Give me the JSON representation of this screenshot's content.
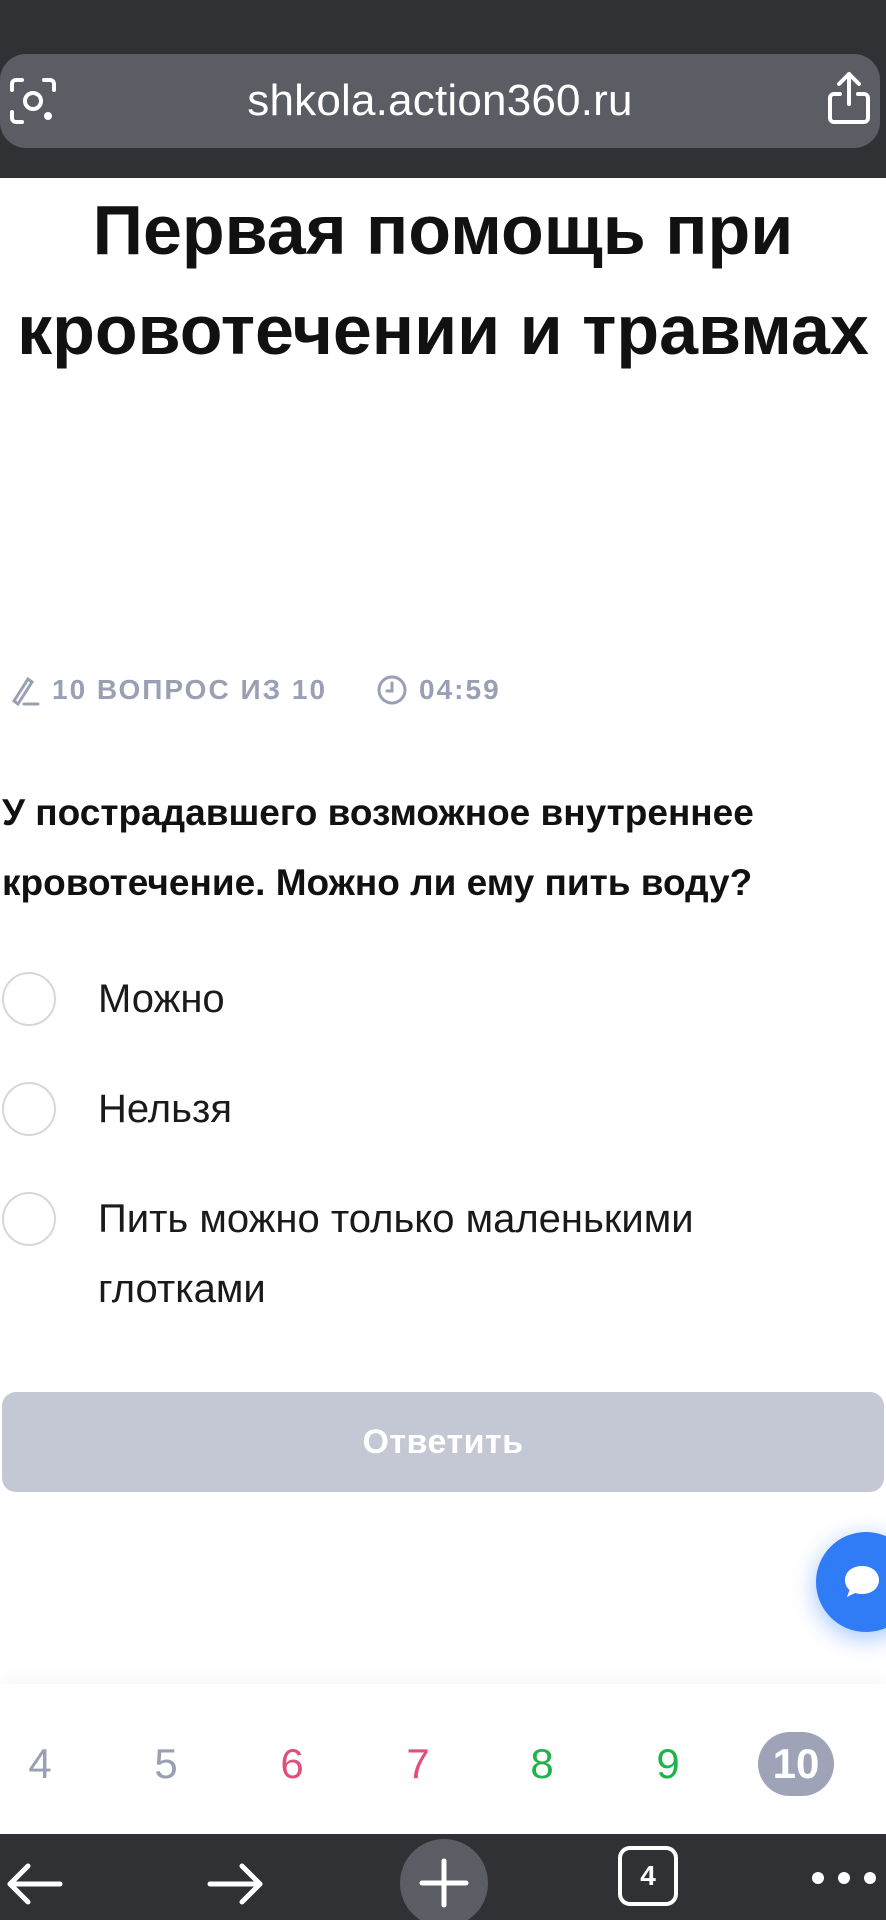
{
  "browser": {
    "url": "shkola.action360.ru",
    "tab_count": "4",
    "icons": [
      "page-scan-icon",
      "share-icon",
      "back-arrow-icon",
      "forward-arrow-icon",
      "new-tab-plus-icon",
      "tabs-icon",
      "more-dots-icon"
    ]
  },
  "quiz": {
    "title": "Первая помощь при кровотечении и травмах",
    "progress_label": "10 ВОПРОС ИЗ 10",
    "timer": "04:59",
    "question": "У пострадавшего возможное внутреннее кровотечение. Можно ли ему пить воду?",
    "options": [
      {
        "label": "Можно",
        "selected": false
      },
      {
        "label": "Нельзя",
        "selected": false
      },
      {
        "label": "Пить можно только маленькими глотками",
        "selected": false
      }
    ],
    "submit_label": "Ответить"
  },
  "pager": {
    "pages": [
      {
        "num": "4",
        "color": "#9aa0b4"
      },
      {
        "num": "5",
        "color": "#9aa0b4"
      },
      {
        "num": "6",
        "color": "#e0507a"
      },
      {
        "num": "7",
        "color": "#e0507a"
      },
      {
        "num": "8",
        "color": "#22b24c"
      },
      {
        "num": "9",
        "color": "#22b24c"
      },
      {
        "num": "10",
        "color": "#9ea3b8"
      }
    ],
    "current": "10"
  },
  "colors": {
    "accent_blue": "#2f7cf6",
    "muted": "#9aa0b4",
    "wrong": "#e0507a",
    "correct": "#22b24c",
    "button_disabled": "#c4c8d4"
  }
}
